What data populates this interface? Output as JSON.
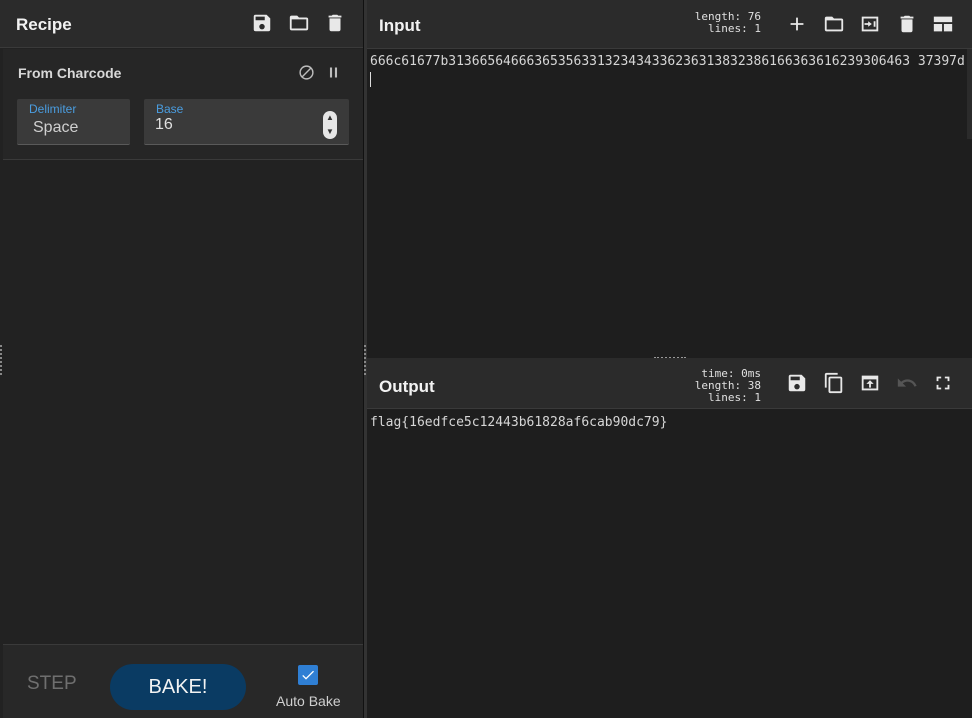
{
  "recipe": {
    "title": "Recipe",
    "icons": [
      "save-icon",
      "folder-icon",
      "trash-icon"
    ],
    "operation": {
      "name": "From Charcode",
      "icons": [
        "disable-icon",
        "pause-icon"
      ],
      "delimiter": {
        "label": "Delimiter",
        "value": "Space"
      },
      "base": {
        "label": "Base",
        "value": "16"
      }
    },
    "footer": {
      "step_label": "STEP",
      "bake_label": "BAKE!",
      "auto_bake_label": "Auto Bake",
      "auto_bake_checked": true
    }
  },
  "input": {
    "title": "Input",
    "stats": {
      "length_label": "length:",
      "length": "76",
      "lines_label": "lines:",
      "lines": "1"
    },
    "icons": [
      "plus-icon",
      "folder-icon",
      "input-to-output-icon",
      "trash-icon",
      "layout-icon"
    ],
    "text": "666c61677b31366564666365356331323434336236313832386166363616239306463 37397d"
  },
  "output": {
    "title": "Output",
    "stats": {
      "time_label": "time:",
      "time": "0ms",
      "length_label": "length:",
      "length": "38",
      "lines_label": "lines:",
      "lines": "1"
    },
    "icons": [
      "save-icon",
      "copy-icon",
      "replace-input-icon",
      "undo-icon",
      "fullscreen-icon"
    ],
    "text": "flag{16edfce5c12443b61828af6cab90dc79}"
  },
  "colors": {
    "accent": "#4a9de0",
    "bake_button": "#0a3b63",
    "checkbox": "#2f7fd4",
    "background": "#1e1e1e"
  }
}
